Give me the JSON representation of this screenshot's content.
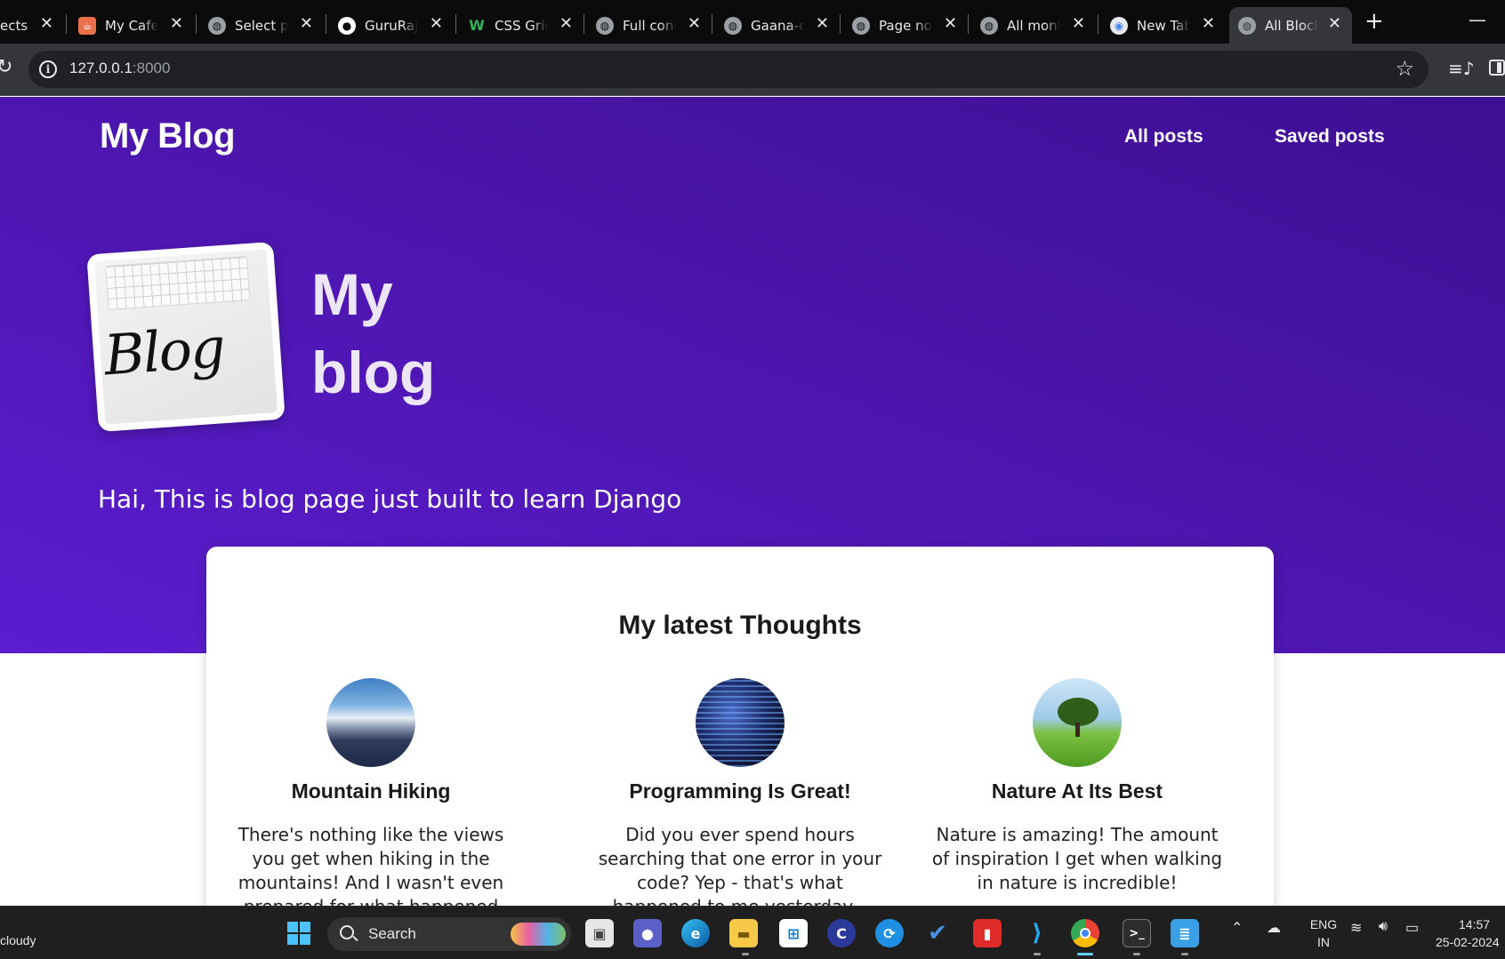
{
  "browser": {
    "tabs": [
      {
        "title": "ects",
        "favicon": "none"
      },
      {
        "title": "My Cafe",
        "favicon": "cafe-icon"
      },
      {
        "title": "Select pr",
        "favicon": "globe-icon"
      },
      {
        "title": "GuruRaj",
        "favicon": "github-icon"
      },
      {
        "title": "CSS Grid",
        "favicon": "w3schools-icon"
      },
      {
        "title": "Full cont",
        "favicon": "globe-icon"
      },
      {
        "title": "Gaana-c",
        "favicon": "globe-icon"
      },
      {
        "title": "Page not",
        "favicon": "globe-icon"
      },
      {
        "title": "All mont",
        "favicon": "globe-icon"
      },
      {
        "title": "New Tab",
        "favicon": "chrome-icon"
      },
      {
        "title": "All Block",
        "favicon": "globe-icon",
        "active": true
      }
    ],
    "url_host": "127.0.0.1",
    "url_port": ":8000"
  },
  "site": {
    "brand": "My Blog",
    "nav": [
      "All posts",
      "Saved posts"
    ],
    "hero_image_text": "Blog",
    "hero_title": "My blog",
    "tagline": "Hai, This is blog page just built to learn Django",
    "section_heading": "My latest Thoughts",
    "posts": [
      {
        "title": "Mountain Hiking",
        "excerpt": "There's nothing like the views you get when hiking in the mountains! And I wasn't even prepared for what happened whilst I was..."
      },
      {
        "title": "Programming Is Great!",
        "excerpt": "Did you ever spend hours searching that one error in your code? Yep - that's what happened to me yesterday..."
      },
      {
        "title": "Nature At Its Best",
        "excerpt": "Nature is amazing! The amount of inspiration I get when walking in nature is incredible!"
      }
    ]
  },
  "taskbar": {
    "weather": "cloudy",
    "search_label": "Search",
    "language": "ENG",
    "region": "IN",
    "time": "14:57",
    "date": "25-02-2024"
  },
  "colors": {
    "hero_start": "#3e0f94",
    "hero_end": "#5b1dd0",
    "tab_bg": "#0b0b0c",
    "toolbar_bg": "#35363a"
  }
}
